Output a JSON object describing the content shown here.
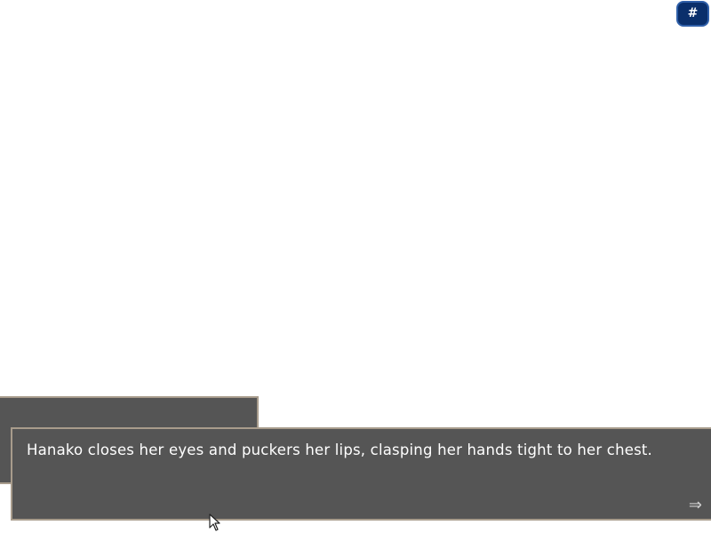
{
  "menu": {
    "label": "#"
  },
  "dialogue": {
    "text": "Hanako closes her eyes and puckers her lips, clasping her hands tight to her chest."
  },
  "icons": {
    "advance": "advance-arrow-icon",
    "cursor": "mouse-pointer-icon"
  },
  "colors": {
    "textbox_bg": "#555555",
    "textbox_border": "#a89c8c",
    "menu_button_bg": "#0a2f6b"
  }
}
